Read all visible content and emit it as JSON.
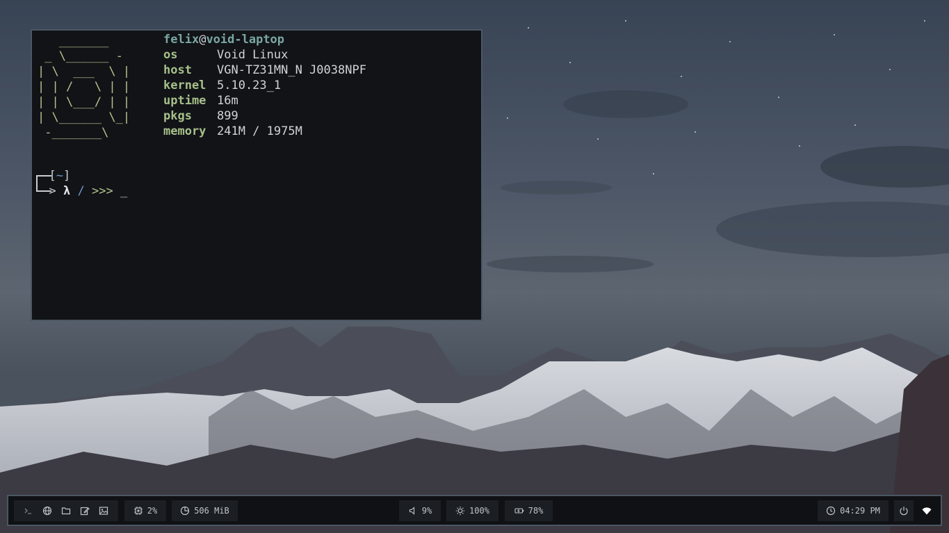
{
  "terminal": {
    "ascii_logo": "   _______\n _ \\______ -\n| \\  ___  \\ |\n| | /   \\ | |\n| | \\___/ | |\n| \\______ \\_|\n -_______\\",
    "fetch": {
      "user": "felix",
      "at": "@",
      "host": "void-laptop",
      "rows": [
        {
          "key": "os",
          "value": "Void Linux"
        },
        {
          "key": "host",
          "value": "VGN-TZ31MN_N J0038NPF"
        },
        {
          "key": "kernel",
          "value": "5.10.23_1"
        },
        {
          "key": "uptime",
          "value": "16m"
        },
        {
          "key": "pkgs",
          "value": "899"
        },
        {
          "key": "memory",
          "value": "241M / 1975M"
        }
      ]
    },
    "prompt": {
      "open_bracket": "[",
      "cwd": "~",
      "close_bracket": "]",
      "arrow": "> ",
      "lambda": "λ",
      "slash": "/",
      "arrows": ">>>",
      "cursor": "_"
    }
  },
  "bar": {
    "launchers": [
      "terminal-icon",
      "globe-icon",
      "folder-icon",
      "edit-icon",
      "image-icon"
    ],
    "cpu": {
      "icon": "cpu-icon",
      "value": "2%"
    },
    "memory": {
      "icon": "memory-icon",
      "value": "506 MiB"
    },
    "volume": {
      "icon": "volume-icon",
      "value": "9%"
    },
    "brightness": {
      "icon": "brightness-icon",
      "value": "100%"
    },
    "battery": {
      "icon": "battery-icon",
      "value": "78%"
    },
    "clock": {
      "icon": "clock-icon",
      "value": "04:29 PM"
    },
    "power": {
      "icon": "power-icon"
    },
    "wifi": {
      "icon": "wifi-icon"
    }
  }
}
